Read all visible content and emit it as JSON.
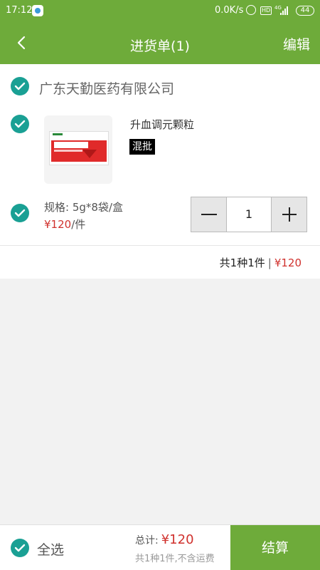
{
  "status_bar": {
    "time": "17:12",
    "speed": "0.0K/s",
    "hd": "HD",
    "network": "4G",
    "battery": "44"
  },
  "nav": {
    "title": "进货单(1)",
    "edit_label": "编辑",
    "back_icon": "chevron-left-icon"
  },
  "store": {
    "name": "广东天勤医药有限公司",
    "checked": true
  },
  "product": {
    "name": "升血调元颗粒",
    "badge": "混批",
    "spec": "规格: 5g*8袋/盒",
    "price": "¥120",
    "price_unit": "/件",
    "quantity": "1",
    "checked": true
  },
  "summary": {
    "count_text": "共1种1件",
    "separator": "|",
    "total": "¥120"
  },
  "footer": {
    "select_all_label": "全选",
    "total_label": "总计:",
    "total_value": "¥120",
    "note": "共1种1件,不含运费",
    "checkout_label": "结算"
  },
  "colors": {
    "primary": "#6eab3a",
    "check": "#1aa094",
    "price": "#d0312d"
  }
}
